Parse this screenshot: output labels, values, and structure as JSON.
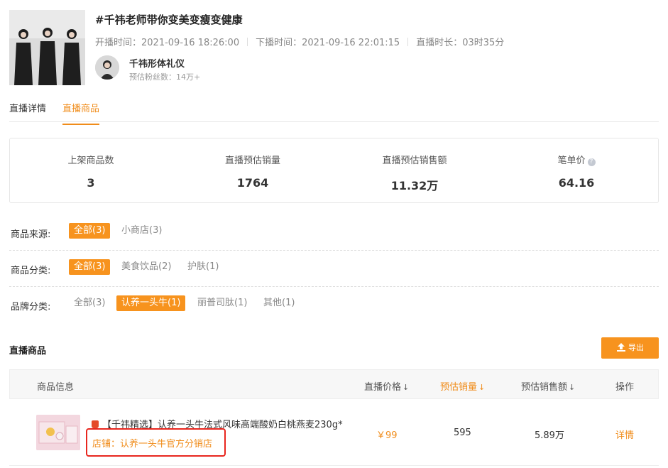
{
  "live": {
    "title": "#千祎老师带你变美变瘦变健康",
    "start_label": "开播时间：",
    "start_time": "2021-09-16 18:26:00",
    "end_label": "下播时间：",
    "end_time": "2021-09-16 22:01:15",
    "duration_label": "直播时长：",
    "duration": "03时35分"
  },
  "author": {
    "name": "千祎形体礼仪",
    "fans_label": "预估粉丝数：",
    "fans": "14万+"
  },
  "tabs": [
    {
      "label": "直播详情",
      "active": false
    },
    {
      "label": "直播商品",
      "active": true
    }
  ],
  "stats": [
    {
      "label": "上架商品数",
      "value": "3"
    },
    {
      "label": "直播预估销量",
      "value": "1764"
    },
    {
      "label": "直播预估销售额",
      "value": "11.32万"
    },
    {
      "label": "笔单价",
      "value": "64.16"
    }
  ],
  "filters": {
    "source": {
      "label": "商品来源:",
      "options": [
        "全部(3)",
        "小商店(3)"
      ],
      "selected": 0
    },
    "category": {
      "label": "商品分类:",
      "options": [
        "全部(3)",
        "美食饮品(2)",
        "护肤(1)"
      ],
      "selected": 0
    },
    "brand": {
      "label": "品牌分类:",
      "options": [
        "全部(3)",
        "认养一头牛(1)",
        "丽普司肽(1)",
        "其他(1)"
      ],
      "selected": 1
    }
  },
  "products_section": {
    "title": "直播商品",
    "export_label": "导出"
  },
  "table": {
    "headers": {
      "info": "商品信息",
      "price": "直播价格",
      "sales": "预估销量",
      "revenue": "预估销售额",
      "action": "操作"
    },
    "rows": [
      {
        "name": "【千祎精选】认养一头牛法式风味高端酸奶白桃燕麦230g*",
        "shop": "店铺：认养一头牛官方分销店",
        "price": "￥99",
        "sales": "595",
        "revenue": "5.89万",
        "action": "详情"
      }
    ]
  },
  "colors": {
    "accent": "#f7931e",
    "highlight_box": "#e8261e"
  }
}
